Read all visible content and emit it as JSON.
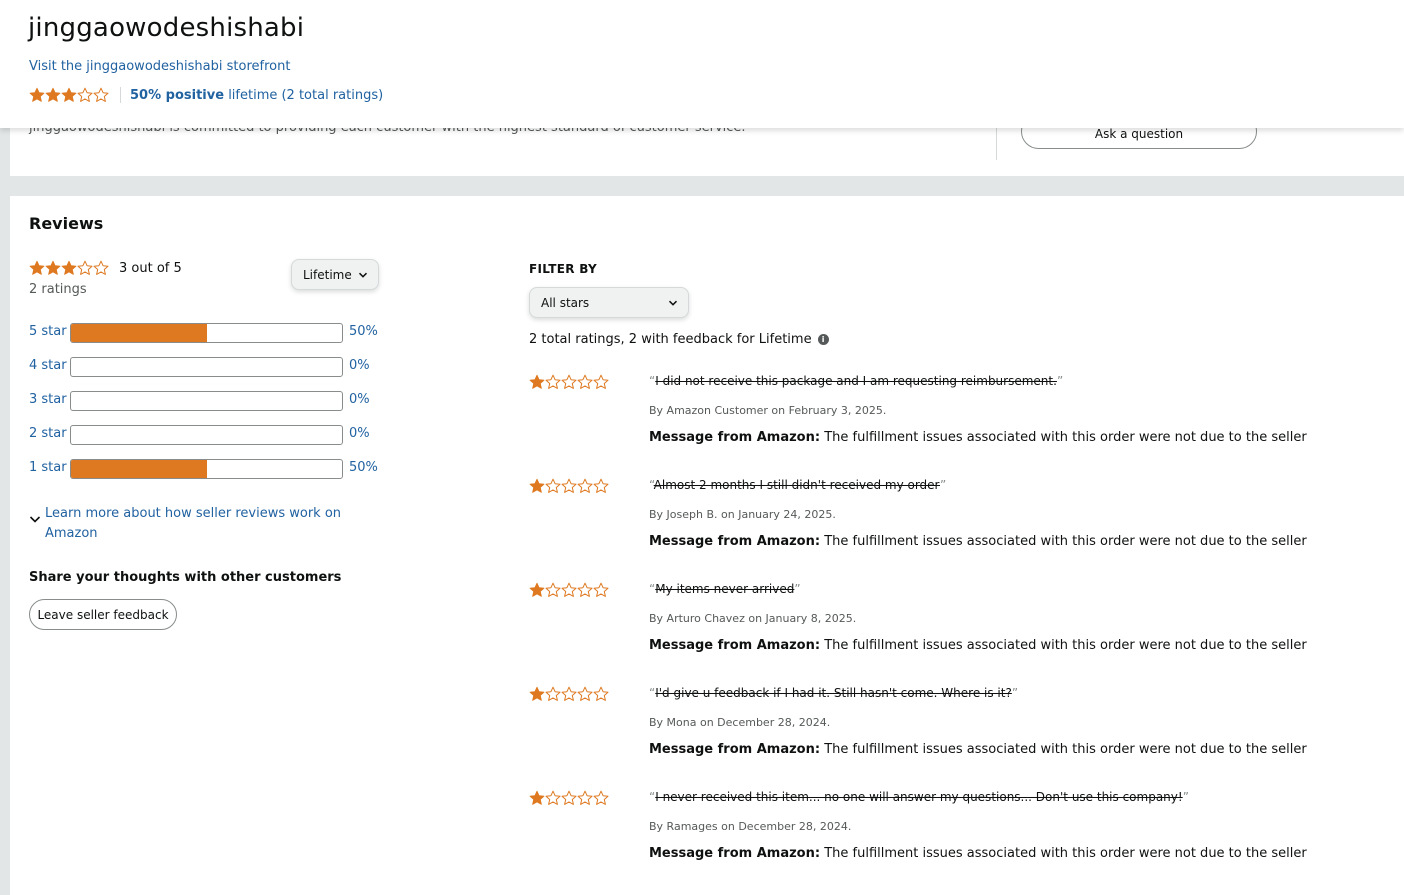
{
  "header": {
    "seller_name": "jinggaowodeshishabi",
    "storefront_link": "Visit the jinggaowodeshishabi storefront",
    "rating_stars": 3,
    "positive_bold": "50% positive",
    "positive_rest": "lifetime (2 total ratings)"
  },
  "about": {
    "text": "jinggaowodeshishabi is committed to providing each customer with the highest standard of customer service.",
    "ask_button": "Ask a question"
  },
  "reviews": {
    "title": "Reviews",
    "average_stars": 3,
    "average_text": "3 out of  5",
    "ratings_count": "2 ratings",
    "period_select": "Lifetime",
    "histogram": [
      {
        "label": "5 star",
        "percent": "50%",
        "fill": 0.5
      },
      {
        "label": "4 star",
        "percent": "0%",
        "fill": 0
      },
      {
        "label": "3 star",
        "percent": "0%",
        "fill": 0
      },
      {
        "label": "2 star",
        "percent": "0%",
        "fill": 0
      },
      {
        "label": "1 star",
        "percent": "50%",
        "fill": 0.5
      }
    ],
    "learn_more": "Learn more about how seller reviews work on Amazon",
    "share_title": "Share your thoughts with other customers",
    "feedback_button": "Leave seller feedback"
  },
  "filter": {
    "title": "FILTER BY",
    "stars_select": "All stars",
    "summary": "2 total ratings, 2 with feedback for Lifetime"
  },
  "review_list": [
    {
      "stars": 1,
      "text": "I did not receive this package and I am requesting reimbursement.",
      "byline": "By Amazon Customer on February 3, 2025.",
      "message_label": "Message from Amazon:",
      "message": "The fulfillment issues associated with this order were not due to the seller"
    },
    {
      "stars": 1,
      "text": "Almost 2 months I still didn't received my order",
      "byline": "By Joseph B. on January 24, 2025.",
      "message_label": "Message from Amazon:",
      "message": "The fulfillment issues associated with this order were not due to the seller"
    },
    {
      "stars": 1,
      "text": "My items never arrived",
      "byline": "By Arturo Chavez on January 8, 2025.",
      "message_label": "Message from Amazon:",
      "message": "The fulfillment issues associated with this order were not due to the seller"
    },
    {
      "stars": 1,
      "text": "I'd give u feedback if I had it. Still hasn't come. Where is it?",
      "byline": "By Mona on December 28, 2024.",
      "message_label": "Message from Amazon:",
      "message": "The fulfillment issues associated with this order were not due to the seller"
    },
    {
      "stars": 1,
      "text": "I never received this item... no one will answer my questions... Don't use this company!",
      "byline": "By Ramages on December 28, 2024.",
      "message_label": "Message from Amazon:",
      "message": "The fulfillment issues associated with this order were not due to the seller"
    }
  ],
  "colors": {
    "star": "#de7921",
    "link": "#2162a1",
    "bar_fill": "#de7921"
  }
}
